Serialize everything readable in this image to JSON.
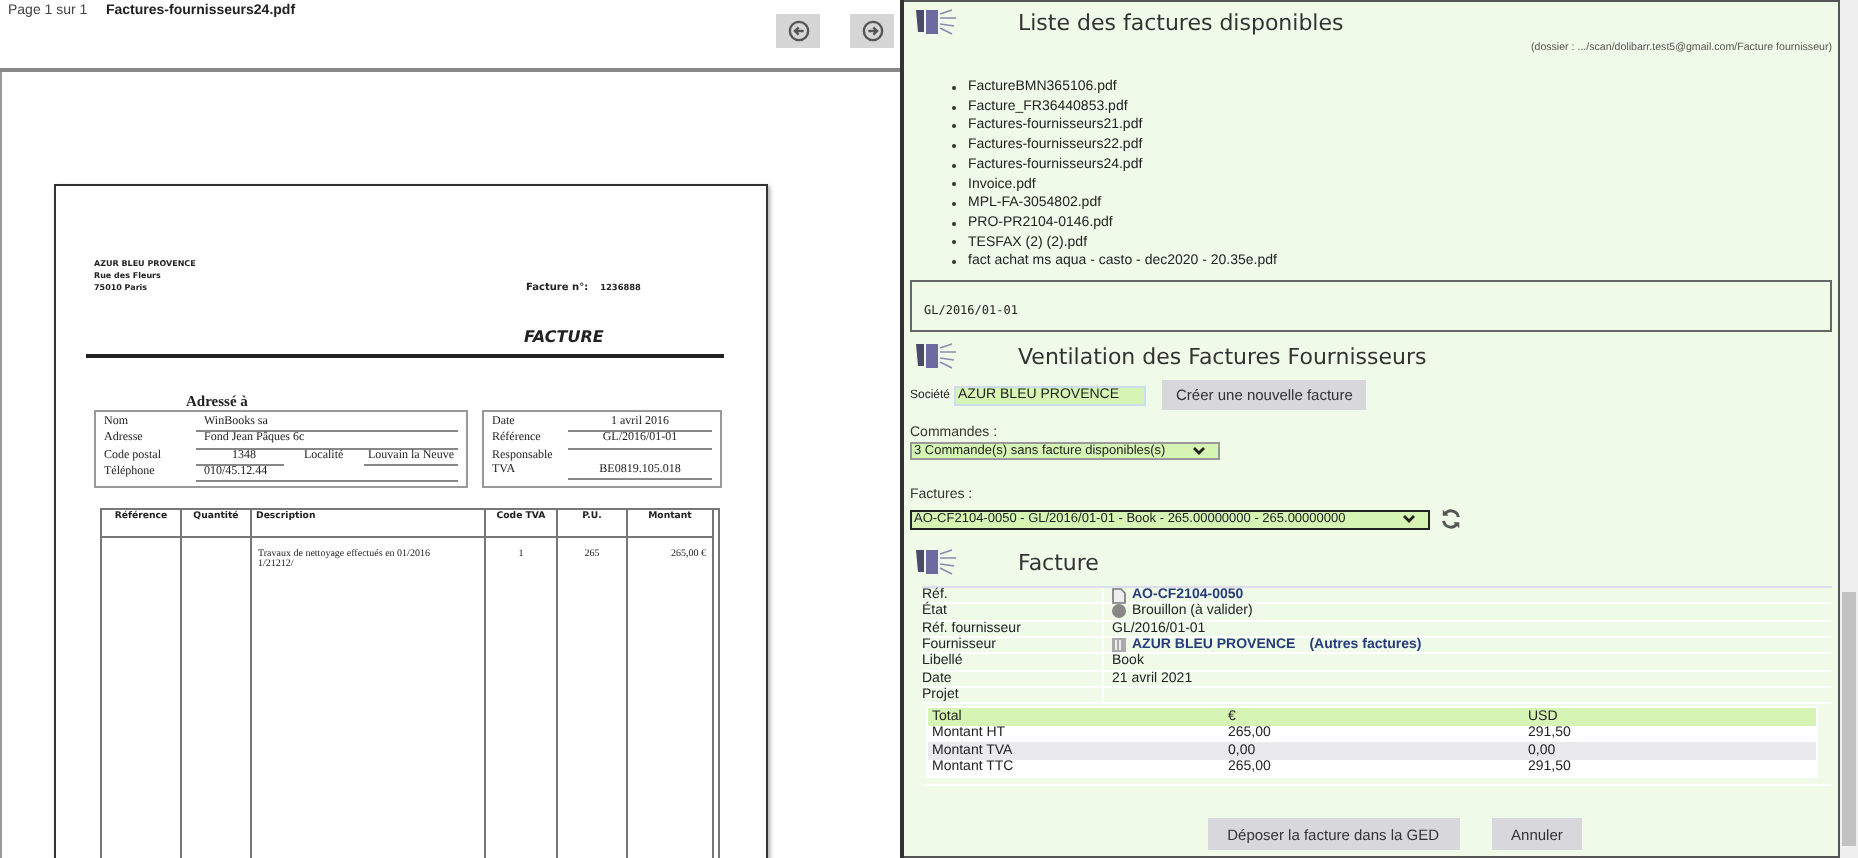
{
  "viewer": {
    "page_label": "Page",
    "page": "1",
    "of_label": "sur",
    "pages": "1",
    "filename": "Factures-fournisseurs24.pdf"
  },
  "document": {
    "sender": [
      "AZUR BLEU PROVENCE",
      "Rue des Fleurs",
      "75010 Paris"
    ],
    "invoice_no_label": "Facture n°:",
    "invoice_no": "1236888",
    "title": "FACTURE",
    "address_heading": "Adressé à",
    "address_rows": [
      {
        "label": "Nom",
        "value": "WinBooks sa"
      },
      {
        "label": "Adresse",
        "value": "Fond Jean Pâques 6c"
      },
      {
        "label": "Code postal",
        "value": "1348",
        "label_2": "Localité",
        "value_2": "Louvain la Neuve"
      },
      {
        "label": "Téléphone",
        "value": "010/45.12.44"
      }
    ],
    "info_rows": [
      {
        "label": "Date",
        "value": "1 avril 2016"
      },
      {
        "label": "Référence",
        "value": "GL/2016/01-01"
      },
      {
        "label": "Responsable"
      },
      {
        "label": "TVA",
        "value": "BE0819.105.018"
      }
    ],
    "columns": [
      "Référence",
      "Quantité",
      "Description",
      "Code TVA",
      "P.U.",
      "Montant"
    ],
    "rows": [
      [
        "",
        "",
        "Travaux de nettoyage effectués en 01/2016 1/21212/",
        "1",
        "265",
        "265,00 €"
      ]
    ]
  },
  "file_list": {
    "title": "Liste des factures disponibles",
    "folder_note": "(dossier : .../scan/dolibarr.test5@gmail.com/Facture fournisseur)",
    "files": [
      "FactureBMN365106.pdf",
      "Facture_FR36440853.pdf",
      "Factures-fournisseurs21.pdf",
      "Factures-fournisseurs22.pdf",
      "Factures-fournisseurs24.pdf",
      "Invoice.pdf",
      "MPL-FA-3054802.pdf",
      "PRO-PR2104-0146.pdf",
      "TESFAX (2) (2).pdf",
      "fact achat ms aqua - casto - dec2020 - 20.35e.pdf"
    ]
  },
  "ref_box": "GL/2016/01-01",
  "ventilation": {
    "title": "Ventilation des Factures Fournisseurs",
    "company_label": "Société",
    "company": "AZUR BLEU PROVENCE",
    "create_button": "Créer une nouvelle facture",
    "orders_label": "Commandes :",
    "orders_select": "3 Commande(s) sans facture disponibles(s)",
    "invoices_label": "Factures :",
    "invoices_select": "AO-CF2104-0050 - GL/2016/01-01 - Book - 265.00000000 - 265.00000000"
  },
  "invoice": {
    "title": "Facture",
    "fields": [
      {
        "kind": "ref",
        "label": "Réf.",
        "value": "AO-CF2104-0050"
      },
      {
        "kind": "status",
        "label": "État",
        "value": "Brouillon (à valider)"
      },
      {
        "kind": "text",
        "label": "Réf. fournisseur",
        "value": "GL/2016/01-01"
      },
      {
        "kind": "supplier",
        "label": "Fournisseur",
        "value": "AZUR BLEU PROVENCE",
        "link": "(Autres factures)"
      },
      {
        "kind": "text",
        "label": "Libellé",
        "value": "Book"
      },
      {
        "kind": "text",
        "label": "Date",
        "value": "21 avril 2021"
      },
      {
        "kind": "text",
        "label": "Projet"
      }
    ],
    "totals": {
      "columns": [
        "Total",
        "€",
        "USD"
      ],
      "rows": [
        [
          "Montant HT",
          "265,00",
          "291,50"
        ],
        [
          "Montant TVA",
          "0,00",
          "0,00"
        ],
        [
          "Montant TTC",
          "265,00",
          "291,50"
        ]
      ]
    }
  },
  "buttons": [
    "Déposer la facture dans la GED",
    "Annuler"
  ]
}
